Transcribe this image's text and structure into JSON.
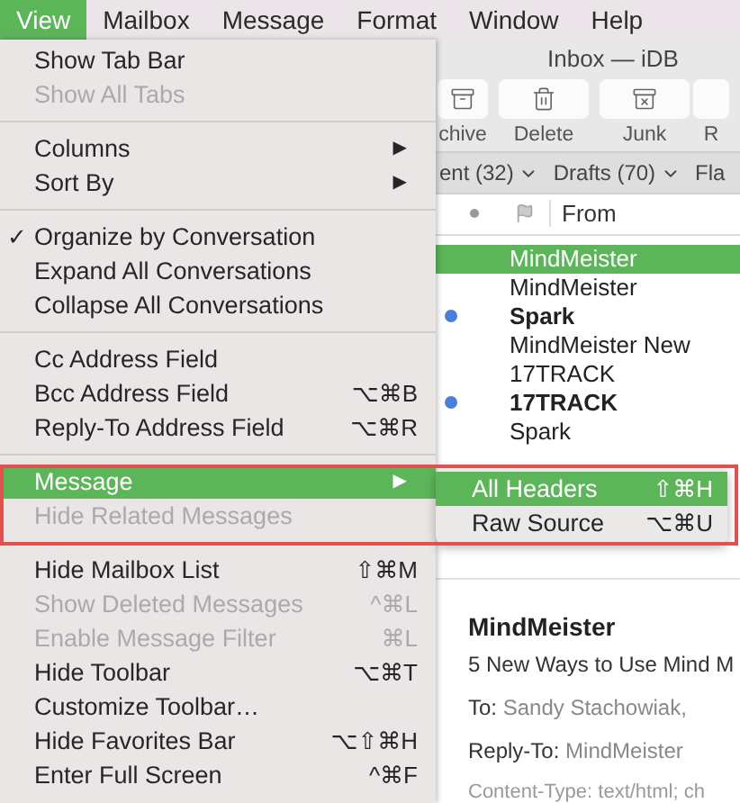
{
  "menubar": [
    {
      "label": "View",
      "selected": true
    },
    {
      "label": "Mailbox",
      "selected": false
    },
    {
      "label": "Message",
      "selected": false
    },
    {
      "label": "Format",
      "selected": false
    },
    {
      "label": "Window",
      "selected": false
    },
    {
      "label": "Help",
      "selected": false
    }
  ],
  "menu": [
    {
      "kind": "item",
      "label": "Show Tab Bar",
      "disabled": false,
      "selected": false
    },
    {
      "kind": "item",
      "label": "Show All Tabs",
      "disabled": true,
      "selected": false
    },
    {
      "kind": "separator"
    },
    {
      "kind": "item",
      "label": "Columns",
      "arrow": "▶",
      "disabled": false,
      "selected": false
    },
    {
      "kind": "item",
      "label": "Sort By",
      "arrow": "▶",
      "disabled": false,
      "selected": false
    },
    {
      "kind": "separator"
    },
    {
      "kind": "item",
      "label": "Organize by Conversation",
      "check": "✓",
      "disabled": false,
      "selected": false
    },
    {
      "kind": "item",
      "label": "Expand All Conversations",
      "disabled": false,
      "selected": false
    },
    {
      "kind": "item",
      "label": "Collapse All Conversations",
      "disabled": false,
      "selected": false
    },
    {
      "kind": "separator"
    },
    {
      "kind": "item",
      "label": "Cc Address Field",
      "disabled": false,
      "selected": false
    },
    {
      "kind": "item",
      "label": "Bcc Address Field",
      "shortcut": "⌥⌘B",
      "disabled": false,
      "selected": false
    },
    {
      "kind": "item",
      "label": "Reply-To Address Field",
      "shortcut": "⌥⌘R",
      "disabled": false,
      "selected": false
    },
    {
      "kind": "separator"
    },
    {
      "kind": "item",
      "label": "Message",
      "arrow": "▶",
      "disabled": false,
      "selected": true
    },
    {
      "kind": "item",
      "label": "Hide Related Messages",
      "disabled": true,
      "selected": false
    },
    {
      "kind": "separator"
    },
    {
      "kind": "item",
      "label": "Hide Mailbox List",
      "shortcut": "⇧⌘M",
      "disabled": false,
      "selected": false
    },
    {
      "kind": "item",
      "label": "Show Deleted Messages",
      "shortcut": "^⌘L",
      "disabled": true,
      "selected": false
    },
    {
      "kind": "item",
      "label": "Enable Message Filter",
      "shortcut": "⌘L",
      "disabled": true,
      "selected": false
    },
    {
      "kind": "item",
      "label": "Hide Toolbar",
      "shortcut": "⌥⌘T",
      "disabled": false,
      "selected": false
    },
    {
      "kind": "item",
      "label": "Customize Toolbar…",
      "disabled": false,
      "selected": false
    },
    {
      "kind": "item",
      "label": "Hide Favorites Bar",
      "shortcut": "⌥⇧⌘H",
      "disabled": false,
      "selected": false
    },
    {
      "kind": "item",
      "label": "Enter Full Screen",
      "shortcut": "^⌘F",
      "disabled": false,
      "selected": false
    }
  ],
  "submenu": [
    {
      "label": "All Headers",
      "shortcut": "⇧⌘H",
      "selected": true
    },
    {
      "label": "Raw Source",
      "shortcut": "⌥⌘U",
      "selected": false
    }
  ],
  "mail": {
    "title": "Inbox — iDB",
    "toolbar": [
      {
        "kind": "archive",
        "label": "chive"
      },
      {
        "kind": "delete",
        "label": "Delete"
      },
      {
        "kind": "junk",
        "label": "Junk"
      },
      {
        "kind": "blank",
        "label": "R"
      }
    ],
    "favorites": [
      {
        "label": "ent (32)",
        "has_menu": true
      },
      {
        "label": "Drafts (70)",
        "has_menu": true
      },
      {
        "label": "Fla",
        "has_menu": false
      }
    ],
    "column": "From",
    "messages": [
      {
        "sender": "MindMeister",
        "unread": false,
        "selected": true
      },
      {
        "sender": "MindMeister",
        "unread": false,
        "selected": false
      },
      {
        "sender": "Spark",
        "unread": true,
        "selected": false
      },
      {
        "sender": "MindMeister New",
        "unread": false,
        "selected": false
      },
      {
        "sender": "17TRACK",
        "unread": false,
        "selected": false
      },
      {
        "sender": "17TRACK",
        "unread": true,
        "selected": false
      },
      {
        "sender": "Spark",
        "unread": false,
        "selected": false
      }
    ],
    "preview": {
      "sender": "MindMeister",
      "subject": "5 New Ways to Use Mind M",
      "fields": [
        {
          "label": "To:",
          "value": "Sandy Stachowiak,"
        },
        {
          "label": "Reply-To:",
          "value": "MindMeister"
        }
      ],
      "content_type": "Content-Type: text/html; ch"
    }
  }
}
